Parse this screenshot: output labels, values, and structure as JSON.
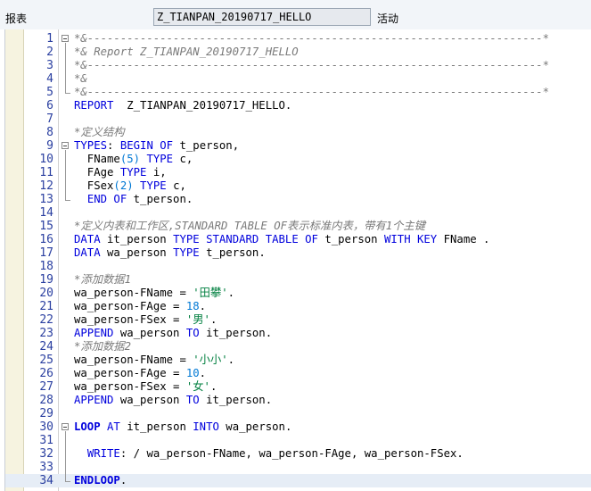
{
  "header": {
    "report_label": "报表",
    "report_name": "Z_TIANPAN_20190717_HELLO",
    "status": "活动"
  },
  "editor": {
    "lines": [
      {
        "n": "1",
        "segs": [
          [
            "c",
            "*&---------------------------------------------------------------------*"
          ]
        ]
      },
      {
        "n": "2",
        "segs": [
          [
            "c",
            "*& Report Z_TIANPAN_20190717_HELLO"
          ]
        ]
      },
      {
        "n": "3",
        "segs": [
          [
            "c",
            "*&---------------------------------------------------------------------*"
          ]
        ]
      },
      {
        "n": "4",
        "segs": [
          [
            "c",
            "*&"
          ]
        ]
      },
      {
        "n": "5",
        "segs": [
          [
            "c",
            "*&---------------------------------------------------------------------*"
          ]
        ]
      },
      {
        "n": "6",
        "segs": [
          [
            "k",
            "REPORT"
          ],
          [
            "",
            "  Z_TIANPAN_20190717_HELLO."
          ]
        ]
      },
      {
        "n": "7",
        "segs": []
      },
      {
        "n": "8",
        "segs": [
          [
            "c",
            "*定义结构"
          ]
        ]
      },
      {
        "n": "9",
        "segs": [
          [
            "k",
            "TYPES"
          ],
          [
            ": "
          ],
          [
            "k",
            "BEGIN OF"
          ],
          [
            " t_person,"
          ]
        ]
      },
      {
        "n": "10",
        "segs": [
          [
            "",
            "  FName"
          ],
          [
            "n",
            "(5)"
          ],
          [
            " "
          ],
          [
            "k",
            "TYPE"
          ],
          [
            " c,"
          ]
        ]
      },
      {
        "n": "11",
        "segs": [
          [
            "",
            "  FAge "
          ],
          [
            "k",
            "TYPE"
          ],
          [
            " i,"
          ]
        ]
      },
      {
        "n": "12",
        "segs": [
          [
            "",
            "  FSex"
          ],
          [
            "n",
            "(2)"
          ],
          [
            " "
          ],
          [
            "k",
            "TYPE"
          ],
          [
            " c,"
          ]
        ]
      },
      {
        "n": "13",
        "segs": [
          [
            "",
            "  "
          ],
          [
            "k",
            "END OF"
          ],
          [
            " t_person."
          ]
        ]
      },
      {
        "n": "14",
        "segs": []
      },
      {
        "n": "15",
        "segs": [
          [
            "c",
            "*定义内表和工作区,STANDARD TABLE OF表示标准内表，带有1个主键"
          ]
        ]
      },
      {
        "n": "16",
        "segs": [
          [
            "k",
            "DATA"
          ],
          [
            " it_person "
          ],
          [
            "k",
            "TYPE STANDARD TABLE OF"
          ],
          [
            " t_person "
          ],
          [
            "k",
            "WITH KEY"
          ],
          [
            " FName ."
          ]
        ]
      },
      {
        "n": "17",
        "segs": [
          [
            "k",
            "DATA"
          ],
          [
            " wa_person "
          ],
          [
            "k",
            "TYPE"
          ],
          [
            " t_person."
          ]
        ]
      },
      {
        "n": "18",
        "segs": []
      },
      {
        "n": "19",
        "segs": [
          [
            "c",
            "*添加数据1"
          ]
        ]
      },
      {
        "n": "20",
        "segs": [
          [
            "",
            "wa_person-FName = "
          ],
          [
            "s",
            "'田攀'"
          ],
          [
            "."
          ]
        ]
      },
      {
        "n": "21",
        "segs": [
          [
            "",
            "wa_person-FAge = "
          ],
          [
            "n",
            "18"
          ],
          [
            "."
          ]
        ]
      },
      {
        "n": "22",
        "segs": [
          [
            "",
            "wa_person-FSex = "
          ],
          [
            "s",
            "'男'"
          ],
          [
            "."
          ]
        ]
      },
      {
        "n": "23",
        "segs": [
          [
            "k",
            "APPEND"
          ],
          [
            " wa_person "
          ],
          [
            "k",
            "TO"
          ],
          [
            " it_person."
          ]
        ]
      },
      {
        "n": "24",
        "segs": [
          [
            "c",
            "*添加数据2"
          ]
        ]
      },
      {
        "n": "25",
        "segs": [
          [
            "",
            "wa_person-FName = "
          ],
          [
            "s",
            "'小小'"
          ],
          [
            "."
          ]
        ]
      },
      {
        "n": "26",
        "segs": [
          [
            "",
            "wa_person-FAge = "
          ],
          [
            "n",
            "10"
          ],
          [
            "."
          ]
        ]
      },
      {
        "n": "27",
        "segs": [
          [
            "",
            "wa_person-FSex = "
          ],
          [
            "s",
            "'女'"
          ],
          [
            "."
          ]
        ]
      },
      {
        "n": "28",
        "segs": [
          [
            "k",
            "APPEND"
          ],
          [
            " wa_person "
          ],
          [
            "k",
            "TO"
          ],
          [
            " it_person."
          ]
        ]
      },
      {
        "n": "29",
        "segs": []
      },
      {
        "n": "30",
        "segs": [
          [
            "kb",
            "LOOP"
          ],
          [
            " "
          ],
          [
            "k",
            "AT"
          ],
          [
            " it_person "
          ],
          [
            "k",
            "INTO"
          ],
          [
            " wa_person."
          ]
        ]
      },
      {
        "n": "31",
        "segs": []
      },
      {
        "n": "32",
        "segs": [
          [
            "",
            "  "
          ],
          [
            "k",
            "WRITE"
          ],
          [
            ": / wa_person-FName, wa_person-FAge, wa_person-FSex."
          ]
        ]
      },
      {
        "n": "33",
        "segs": []
      },
      {
        "n": "34",
        "segs": [
          [
            "kb",
            "ENDLOOP"
          ],
          [
            "."
          ]
        ]
      }
    ]
  }
}
